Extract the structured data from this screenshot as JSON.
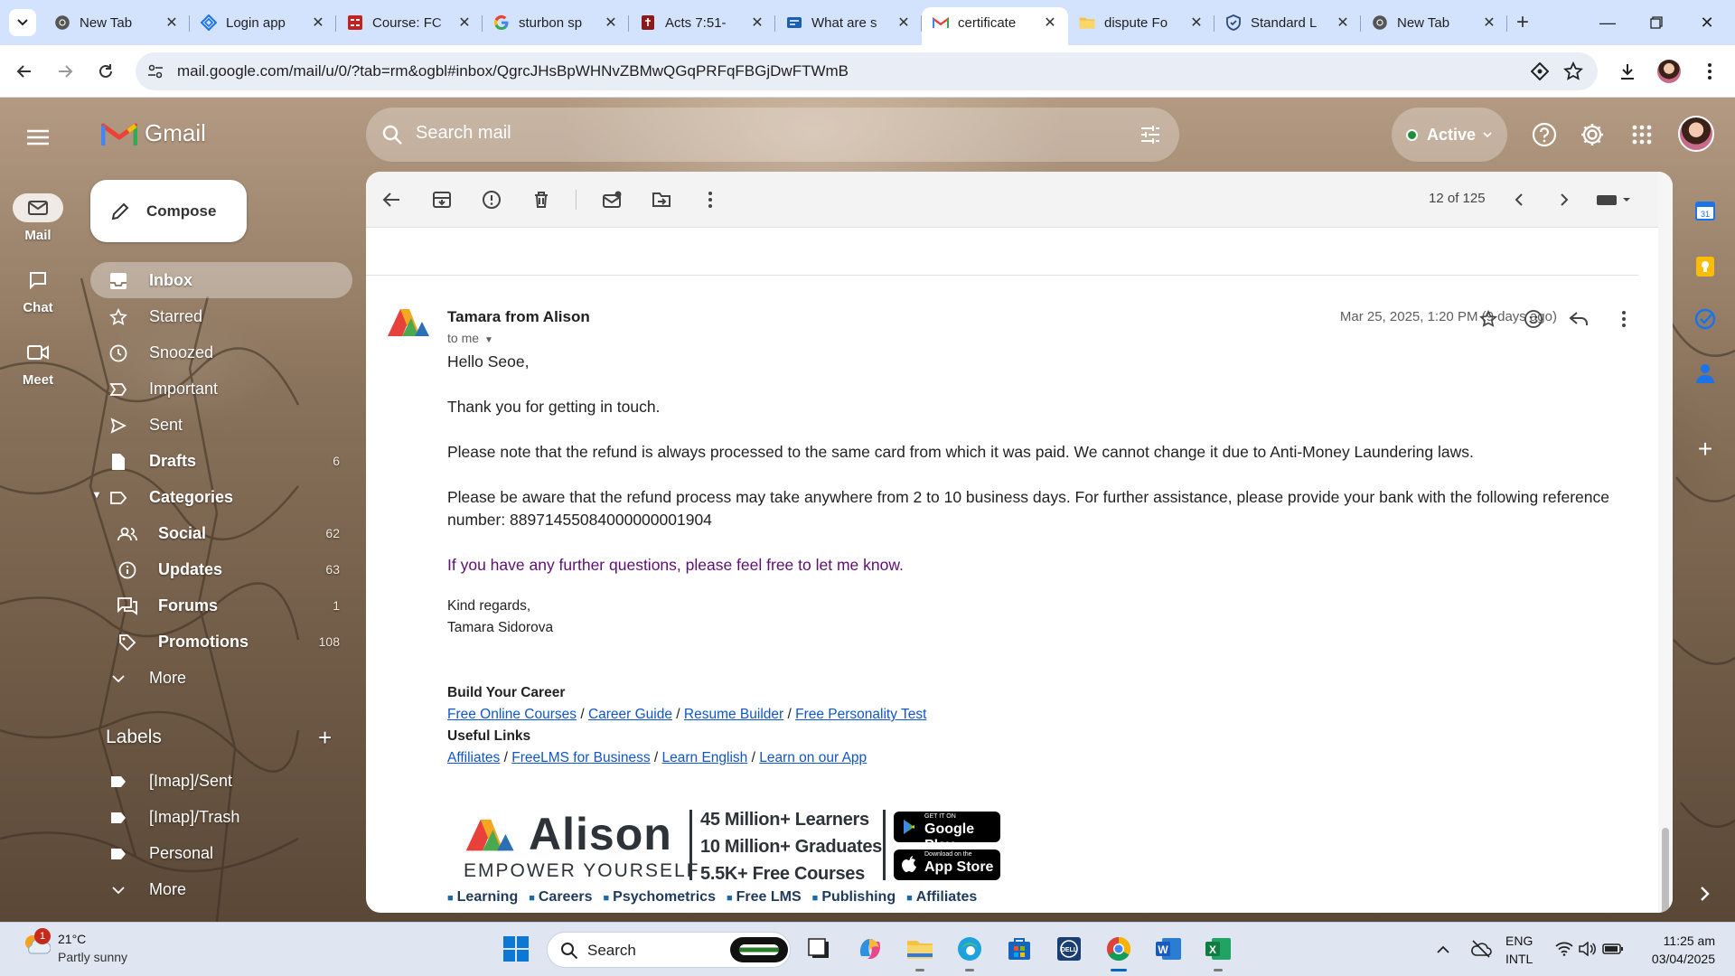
{
  "browser": {
    "tabs": [
      {
        "title": "New Tab",
        "icon": "chrome-icon",
        "active": false
      },
      {
        "title": "Login app",
        "icon": "diamond-icon",
        "active": false
      },
      {
        "title": "Course: FC",
        "icon": "course-icon",
        "active": false
      },
      {
        "title": "sturbon sp",
        "icon": "google-icon",
        "active": false
      },
      {
        "title": "Acts 7:51-",
        "icon": "bible-icon",
        "active": false
      },
      {
        "title": "What are s",
        "icon": "teams-icon",
        "active": false
      },
      {
        "title": "certificate",
        "icon": "gmail-icon",
        "active": true
      },
      {
        "title": "dispute Fo",
        "icon": "folder-icon",
        "active": false
      },
      {
        "title": "Standard L",
        "icon": "shield-icon",
        "active": false
      },
      {
        "title": "New Tab",
        "icon": "chrome-icon",
        "active": false
      }
    ],
    "url": "mail.google.com/mail/u/0/?tab=rm&ogbl#inbox/QgrcJHsBpWHNvZBMwQGqPRFqFBGjDwFTWmB"
  },
  "gmail": {
    "logo": "Gmail",
    "compose": "Compose",
    "rail": [
      {
        "label": "Mail",
        "icon": "mail-icon"
      },
      {
        "label": "Chat",
        "icon": "chat-icon"
      },
      {
        "label": "Meet",
        "icon": "video-icon"
      }
    ],
    "nav": [
      {
        "label": "Inbox",
        "icon": "inbox-icon",
        "count": "",
        "active": true
      },
      {
        "label": "Starred",
        "icon": "star-icon",
        "count": ""
      },
      {
        "label": "Snoozed",
        "icon": "clock-icon",
        "count": ""
      },
      {
        "label": "Important",
        "icon": "important-icon",
        "count": ""
      },
      {
        "label": "Sent",
        "icon": "send-icon",
        "count": ""
      },
      {
        "label": "Drafts",
        "icon": "draft-icon",
        "count": "6"
      },
      {
        "label": "Categories",
        "icon": "label-icon",
        "count": ""
      },
      {
        "label": "Social",
        "icon": "people-icon",
        "count": "62"
      },
      {
        "label": "Updates",
        "icon": "info-icon",
        "count": "63"
      },
      {
        "label": "Forums",
        "icon": "forum-icon",
        "count": "1"
      },
      {
        "label": "Promotions",
        "icon": "tag-icon",
        "count": "108"
      },
      {
        "label": "More",
        "icon": "chevron-down-icon",
        "count": ""
      }
    ],
    "labels_heading": "Labels",
    "labels": [
      {
        "label": "[Imap]/Sent"
      },
      {
        "label": "[Imap]/Trash"
      },
      {
        "label": "Personal"
      },
      {
        "label": "More"
      }
    ],
    "search_placeholder": "Search mail",
    "status": "Active",
    "pager": "12 of 125"
  },
  "email": {
    "sender": "Tamara from Alison",
    "to": "to me",
    "date": "Mar 25, 2025, 1:20 PM (9 days ago)",
    "greeting": "Hello Seoe,",
    "p1": "Thank you for getting in touch.",
    "p2": "Please note that the refund is always processed to the same card from which it was paid. We cannot change it due to Anti-Money Laundering laws.",
    "p3": "Please be aware that the refund process may take anywhere from 2 to 10 business days. For further assistance, please provide your bank with the following reference number: 88971455084000000001904",
    "p4": "If you have any further questions, please feel free to let me know.",
    "closing": "Kind regards,",
    "signature": "Tamara Sidorova",
    "footer": {
      "h1": "Build Your Career",
      "links1": [
        "Free Online Courses",
        "Career Guide",
        "Resume Builder",
        "Free Personality Test"
      ],
      "h2": "Useful Links",
      "links2": [
        "Affiliates",
        "FreeLMS for Business",
        "Learn English",
        "Learn on our App"
      ]
    },
    "banner": {
      "brand": "Alison",
      "tagline": "EMPOWER YOURSELF",
      "stats": [
        "45 Million+ Learners",
        "10 Million+ Graduates",
        "5.5K+ Free Courses"
      ],
      "google_play_small": "GET IT ON",
      "google_play": "Google Play",
      "app_store_small": "Download on the",
      "app_store": "App Store",
      "categories": [
        "Learning",
        "Careers",
        "Psychometrics",
        "Free LMS",
        "Publishing",
        "Affiliates"
      ]
    }
  },
  "taskbar": {
    "badge": "1",
    "temp": "21°C",
    "condition": "Partly sunny",
    "search": "Search",
    "lang1": "ENG",
    "lang2": "INTL",
    "time": "11:25 am",
    "date": "03/04/2025"
  }
}
